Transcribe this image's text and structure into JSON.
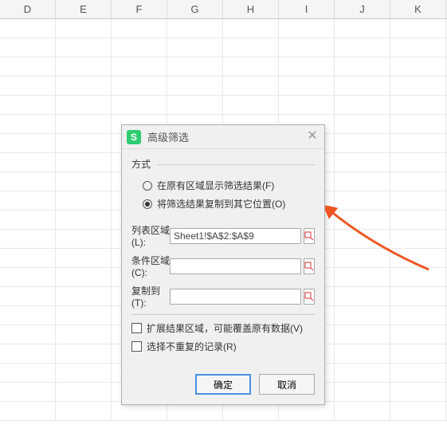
{
  "columns": [
    "D",
    "E",
    "F",
    "G",
    "H",
    "I",
    "J",
    "K"
  ],
  "dialog": {
    "logo": "S",
    "title": "高级筛选",
    "method_label": "方式",
    "radios": {
      "in_place": "在原有区域显示筛选结果(F)",
      "copy_to": "将筛选结果复制到其它位置(O)"
    },
    "fields": {
      "list_label": "列表区域(L):",
      "list_value": "Sheet1!$A$2:$A$9",
      "criteria_label": "条件区域(C):",
      "criteria_value": "",
      "copyto_label": "复制到(T):",
      "copyto_value": ""
    },
    "checkboxes": {
      "extend": "扩展结果区域，可能覆盖原有数据(V)",
      "unique": "选择不重复的记录(R)"
    },
    "buttons": {
      "ok": "确定",
      "cancel": "取消"
    }
  }
}
